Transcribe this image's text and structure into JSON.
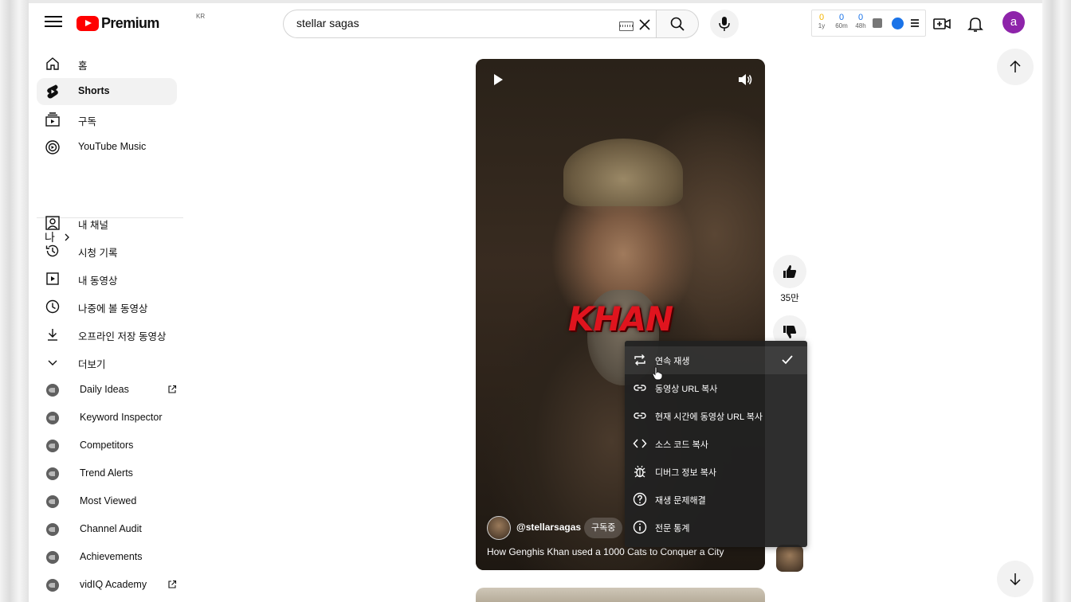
{
  "header": {
    "logo_word": "Premium",
    "region": "KR",
    "search": {
      "value": "stellar sagas",
      "placeholder": ""
    },
    "vidiq": {
      "stats": [
        {
          "value": "0",
          "label": "1y",
          "color": "#f5b400"
        },
        {
          "value": "0",
          "label": "60m",
          "color": "#1a73e8"
        },
        {
          "value": "0",
          "label": "48h",
          "color": "#1a73e8"
        }
      ]
    },
    "avatar_letter": "a"
  },
  "sidebar": {
    "main": [
      {
        "label": "홈",
        "icon": "home-icon"
      },
      {
        "label": "Shorts",
        "icon": "shorts-icon",
        "active": true
      },
      {
        "label": "구독",
        "icon": "subscriptions-icon"
      },
      {
        "label": "YouTube Music",
        "icon": "youtube-music-icon"
      }
    ],
    "you_section": {
      "title": "나",
      "items": [
        {
          "label": "내 채널",
          "icon": "your-channel-icon"
        },
        {
          "label": "시청 기록",
          "icon": "history-icon"
        },
        {
          "label": "내 동영상",
          "icon": "your-videos-icon"
        },
        {
          "label": "나중에 볼 동영상",
          "icon": "watch-later-icon"
        },
        {
          "label": "오프라인 저장 동영상",
          "icon": "downloads-icon"
        },
        {
          "label": "더보기",
          "icon": "chevron-down-icon"
        }
      ]
    },
    "vidiq_items": [
      {
        "label": "Daily Ideas",
        "external": true
      },
      {
        "label": "Keyword Inspector"
      },
      {
        "label": "Competitors"
      },
      {
        "label": "Trend Alerts"
      },
      {
        "label": "Most Viewed"
      },
      {
        "label": "Channel Audit"
      },
      {
        "label": "Achievements"
      },
      {
        "label": "vidIQ Academy",
        "external": true
      }
    ]
  },
  "short": {
    "overlay_text": "KHAN",
    "channel_handle": "@stellarsagas",
    "subscribe_label": "구독중",
    "title": "How Genghis Khan used a 1000 Cats to Conquer a City"
  },
  "actions": {
    "like_count": "35만"
  },
  "context_menu": {
    "items": [
      {
        "label": "연속 재생",
        "icon": "loop-icon",
        "checked": true
      },
      {
        "label": "동영상 URL 복사",
        "icon": "link-icon"
      },
      {
        "label": "현재 시간에 동영상 URL 복사",
        "icon": "link-icon"
      },
      {
        "label": "소스 코드 복사",
        "icon": "code-icon"
      },
      {
        "label": "디버그 정보 복사",
        "icon": "bug-icon"
      },
      {
        "label": "재생 문제해결",
        "icon": "help-icon"
      },
      {
        "label": "전문 통계",
        "icon": "info-icon"
      }
    ]
  },
  "colors": {
    "brand_red": "#ff0000",
    "avatar_purple": "#8e24aa",
    "menu_bg": "#212121",
    "khan_red": "#e0141e"
  }
}
